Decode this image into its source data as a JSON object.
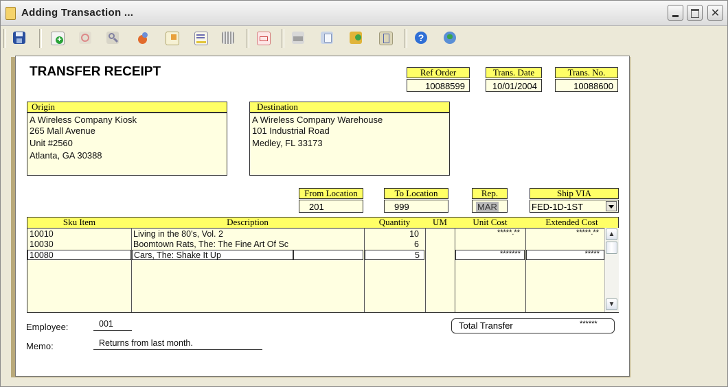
{
  "window": {
    "title": "Adding Transaction ...",
    "close_glyph": "✕"
  },
  "toolbar": {
    "icons": [
      "save-icon",
      "add-record-icon",
      "delete-record-icon",
      "search-icon",
      "find-replace-icon",
      "export-icon",
      "notes-icon",
      "barcode-icon",
      "tag-icon",
      "print-icon",
      "copy-icon",
      "box-icon",
      "paste-icon",
      "help-icon",
      "world-icon"
    ]
  },
  "form": {
    "title": "TRANSFER RECEIPT",
    "ref_order": {
      "label": "Ref Order",
      "value": "10088599"
    },
    "trans_date": {
      "label": "Trans. Date",
      "value": "10/01/2004"
    },
    "trans_no": {
      "label": "Trans. No.",
      "value": "10088600"
    },
    "origin": {
      "label": "Origin",
      "lines": [
        "A Wireless Company Kiosk",
        "265 Mall Avenue",
        "Unit #2560",
        "Atlanta, GA 30388"
      ]
    },
    "destination": {
      "label": "Destination",
      "lines": [
        "A Wireless Company Warehouse",
        "101 Industrial Road",
        "Medley, FL 33173"
      ]
    },
    "from_location": {
      "label": "From Location",
      "value": "201"
    },
    "to_location": {
      "label": "To Location",
      "value": "999"
    },
    "rep": {
      "label": "Rep.",
      "value": "MAR"
    },
    "ship_via": {
      "label": "Ship VIA",
      "value": "FED-1D-1ST"
    },
    "grid": {
      "columns": [
        "Sku Item",
        "Description",
        "Quantity",
        "UM",
        "Unit Cost",
        "Extended Cost"
      ],
      "rows": [
        {
          "sku": "10010",
          "description": "Living in the 80's, Vol. 2",
          "quantity": "10",
          "um": "",
          "unit_cost": "*****.**",
          "extended_cost": "*****.**"
        },
        {
          "sku": "10030",
          "description": "Boomtown Rats, The: The Fine Art Of Sc",
          "quantity": "6",
          "um": "",
          "unit_cost": "",
          "extended_cost": ""
        },
        {
          "sku": "10080",
          "description": "Cars, The: Shake It Up",
          "quantity": "5",
          "um": "",
          "unit_cost": "*******",
          "extended_cost": "*****"
        }
      ]
    },
    "employee": {
      "label": "Employee:",
      "value": "001"
    },
    "memo": {
      "label": "Memo:",
      "value": "Returns from last month."
    },
    "total": {
      "label": "Total Transfer",
      "value": "******"
    },
    "colors": {
      "header_yellow": "#ffff66",
      "field_cream": "#ffffe1",
      "background": "#ece9d8"
    }
  }
}
